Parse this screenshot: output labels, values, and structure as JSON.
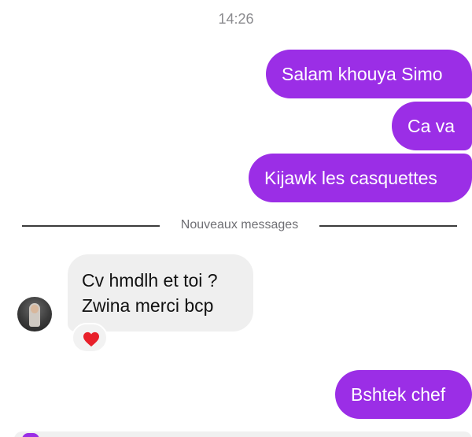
{
  "status": {
    "time": "14:26"
  },
  "messages_out_top": [
    {
      "text": "Salam khouya Simo"
    },
    {
      "text": "Ca va"
    },
    {
      "text": "Kijawk les casquettes"
    }
  ],
  "divider": {
    "label": "Nouveaux messages"
  },
  "message_in": {
    "lines": [
      "Cv hmdlh et toi ?",
      "Zwina merci bcp"
    ],
    "reaction": "heart"
  },
  "message_out_bottom": {
    "text": "Bshtek chef"
  },
  "colors": {
    "outgoing_bubble": "#9b2ee6",
    "incoming_bubble": "#efefef",
    "reaction_heart": "#e8202a"
  }
}
